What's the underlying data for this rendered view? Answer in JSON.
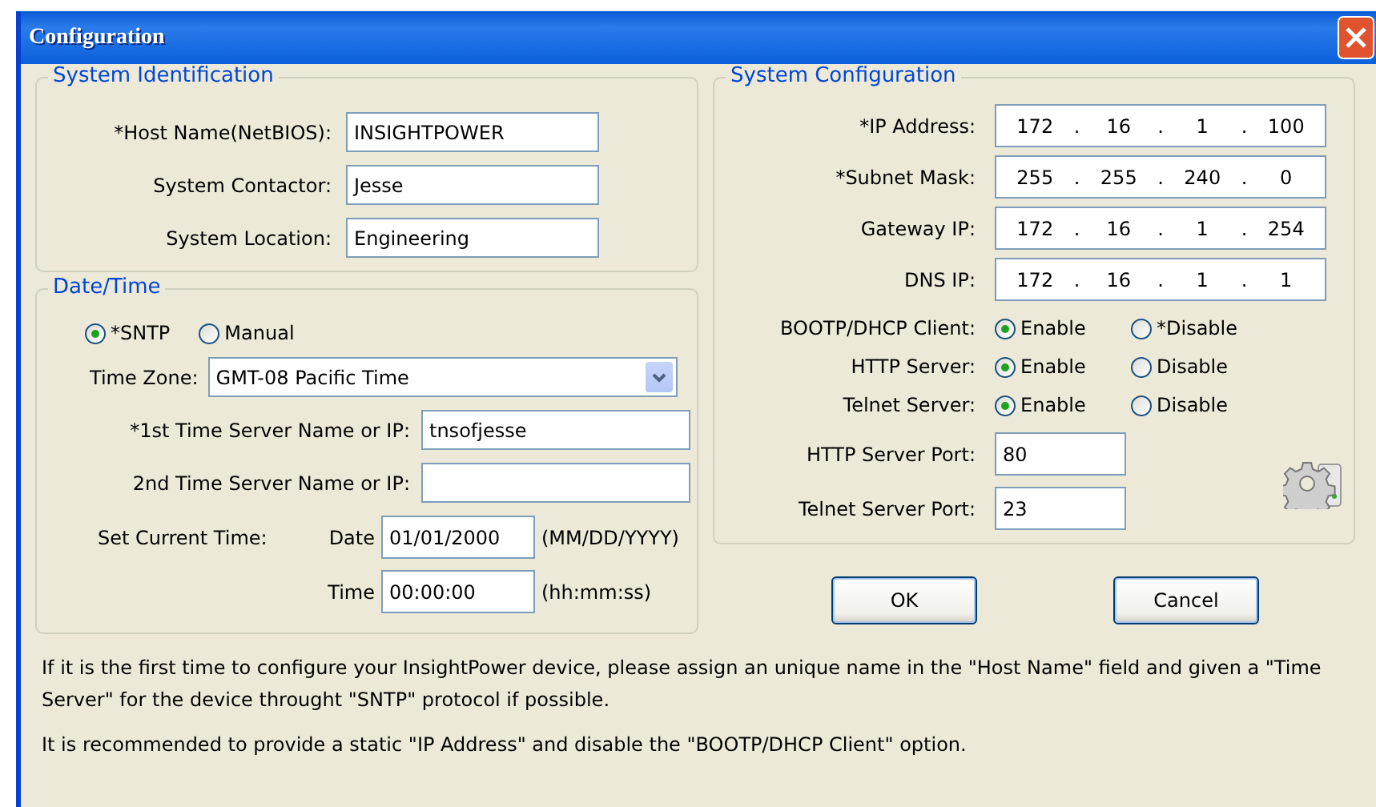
{
  "window": {
    "title": "Configuration"
  },
  "system_identification": {
    "title": "System Identification",
    "fields": [
      {
        "label": "*Host Name(NetBIOS):",
        "value": "INSIGHTPOWER"
      },
      {
        "label": "System Contactor:",
        "value": "Jesse"
      },
      {
        "label": "System Location:",
        "value": "Engineering"
      }
    ]
  },
  "date_time": {
    "title": "Date/Time",
    "modes": [
      {
        "label": "*SNTP",
        "selected": true
      },
      {
        "label": "Manual",
        "selected": false
      }
    ],
    "time_zone": {
      "label": "Time Zone:",
      "value": "GMT-08 Pacific Time"
    },
    "servers": [
      {
        "label": "*1st Time Server Name or IP:",
        "value": "tnsofjesse"
      },
      {
        "label": "2nd Time Server Name or IP:"
      }
    ],
    "set_time": {
      "label": "Set Current Time:",
      "date": {
        "label": "Date",
        "value": "01/01/2000",
        "format": "(MM/DD/YYYY)"
      },
      "time": {
        "label": "Time",
        "value": "00:00:00",
        "format": "(hh:mm:ss)"
      }
    }
  },
  "system_configuration": {
    "title": "System Configuration",
    "separator": ".",
    "addresses": [
      {
        "label": "*IP Address:",
        "octets": [
          "172",
          "16",
          "1",
          "100"
        ]
      },
      {
        "label": "*Subnet Mask:",
        "octets": [
          "255",
          "255",
          "240",
          "0"
        ]
      },
      {
        "label": "Gateway IP:",
        "octets": [
          "172",
          "16",
          "1",
          "254"
        ]
      },
      {
        "label": "DNS IP:",
        "octets": [
          "172",
          "16",
          "1",
          "1"
        ]
      }
    ],
    "services": [
      {
        "label": "BOOTP/DHCP Client:",
        "options": [
          {
            "label": "Enable",
            "selected": true
          },
          {
            "label": "*Disable",
            "selected": false
          }
        ]
      },
      {
        "label": "HTTP Server:",
        "options": [
          {
            "label": "Enable",
            "selected": true
          },
          {
            "label": "Disable",
            "selected": false
          }
        ]
      },
      {
        "label": "Telnet Server:",
        "options": [
          {
            "label": "Enable",
            "selected": true
          },
          {
            "label": "Disable",
            "selected": false
          }
        ]
      }
    ],
    "ports": [
      {
        "label": "HTTP Server Port:",
        "value": "80"
      },
      {
        "label": "Telnet Server Port:",
        "value": "23"
      }
    ]
  },
  "buttons": [
    {
      "label": "OK"
    },
    {
      "label": "Cancel"
    }
  ],
  "notes": [
    "If it is the first time to configure your InsightPower device, please assign an unique name in the \"Host Name\" field and given a \"Time Server\" for the device throught \"SNTP\" protocol if possible.",
    "It is recommended to provide a static \"IP Address\" and disable the \"BOOTP/DHCP Client\" option."
  ]
}
